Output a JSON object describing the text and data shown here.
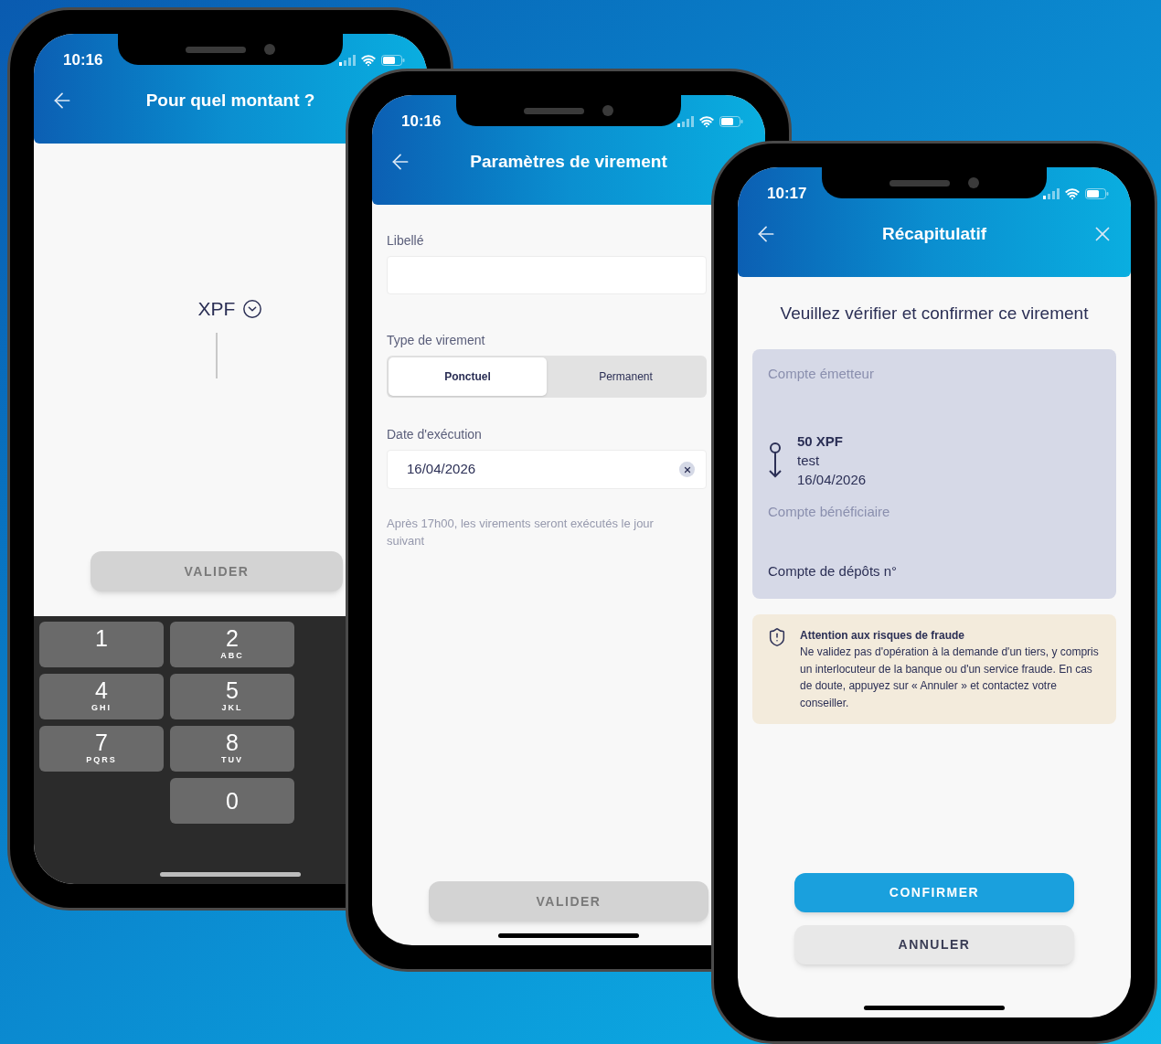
{
  "phones": [
    {
      "kind": "amount",
      "time": "10:16",
      "title": "Pour quel montant ?",
      "currency": "XPF",
      "submit": {
        "label": "VALIDER",
        "disabled": true
      },
      "keypad": [
        {
          "digit": "1"
        },
        {
          "digit": "2",
          "letters": "ABC"
        },
        {
          "digit": "4",
          "letters": "GHI"
        },
        {
          "digit": "5",
          "letters": "JKL"
        },
        {
          "digit": "7",
          "letters": "PQRS"
        },
        {
          "digit": "8",
          "letters": "TUV"
        },
        {
          "digit": "0"
        }
      ]
    },
    {
      "kind": "settings",
      "time": "10:16",
      "title": "Paramètres de virement",
      "label_field": {
        "label": "Libellé"
      },
      "type_field": {
        "label": "Type de virement",
        "options": [
          {
            "label": "Ponctuel",
            "selected": true
          },
          {
            "label": "Permanent",
            "selected": false
          }
        ]
      },
      "date_field": {
        "label": "Date d'exécution",
        "value": "16/04/2026"
      },
      "note": "Après 17h00, les virements seront exécutés le jour",
      "note_end": "suivant",
      "submit": {
        "label": "VALIDER",
        "disabled": true
      }
    },
    {
      "kind": "summary",
      "time": "10:17",
      "title": "Récapitulatif",
      "heading": "Veuillez vérifier et confirmer ce virement",
      "source_label": "Compte émetteur",
      "amount": "50 XPF",
      "reference": "test",
      "date": "16/04/2026",
      "beneficiary_label": "Compte bénéficiaire",
      "beneficiary_account": "Compte de dépôts n°",
      "warning": {
        "title": "Attention aux risques de fraude",
        "text": "Ne validez pas d'opération à la demande d'un tiers, y compris un interlocuteur de la banque ou d'un service fraude. En cas de doute, appuyez sur « Annuler » et contactez votre conseiller."
      },
      "actions": [
        {
          "label": "CONFIRMER",
          "kind": "primary"
        },
        {
          "label": "ANNULER",
          "kind": "secondary"
        }
      ]
    }
  ]
}
